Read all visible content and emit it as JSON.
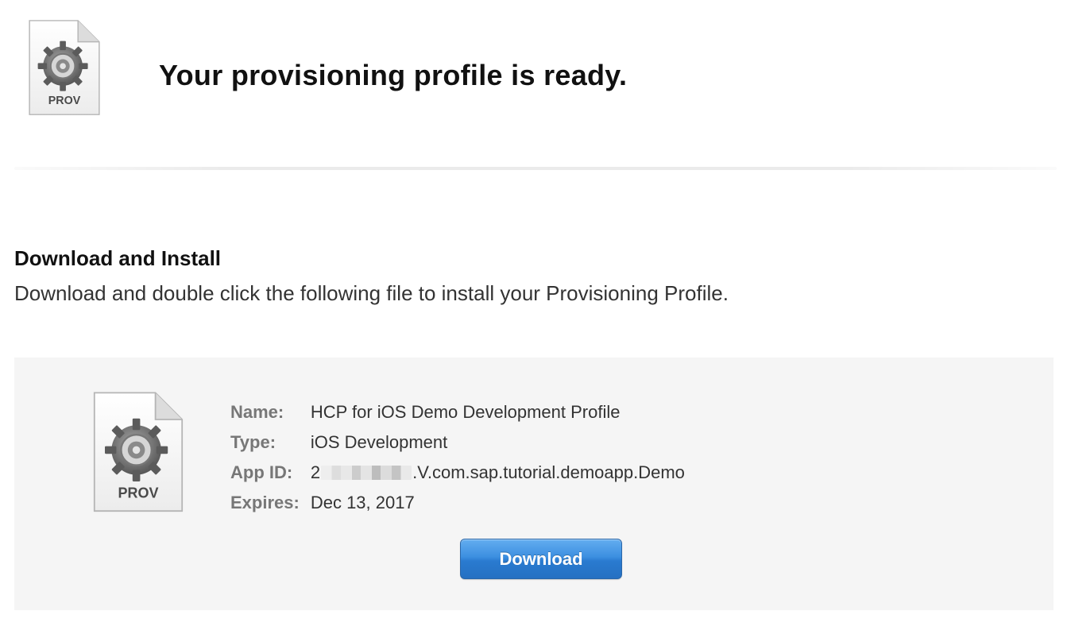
{
  "header": {
    "title": "Your provisioning profile is ready.",
    "icon": "prov-file-icon",
    "icon_label": "PROV"
  },
  "section": {
    "heading": "Download and Install",
    "description": "Download and double click the following file to install your Provisioning Profile."
  },
  "profile": {
    "icon": "prov-file-icon",
    "icon_label": "PROV",
    "fields": [
      {
        "label": "Name:",
        "value": "HCP for iOS Demo Development Profile"
      },
      {
        "label": "Type:",
        "value": "iOS Development"
      },
      {
        "label": "App ID:",
        "value_prefix": "2",
        "value_suffix": ".V.com.sap.tutorial.demoapp.Demo"
      },
      {
        "label": "Expires:",
        "value": "Dec 13, 2017"
      }
    ],
    "download_label": "Download"
  },
  "colors": {
    "button_accent": "#2a7bd0",
    "panel_background": "#f5f5f5"
  }
}
